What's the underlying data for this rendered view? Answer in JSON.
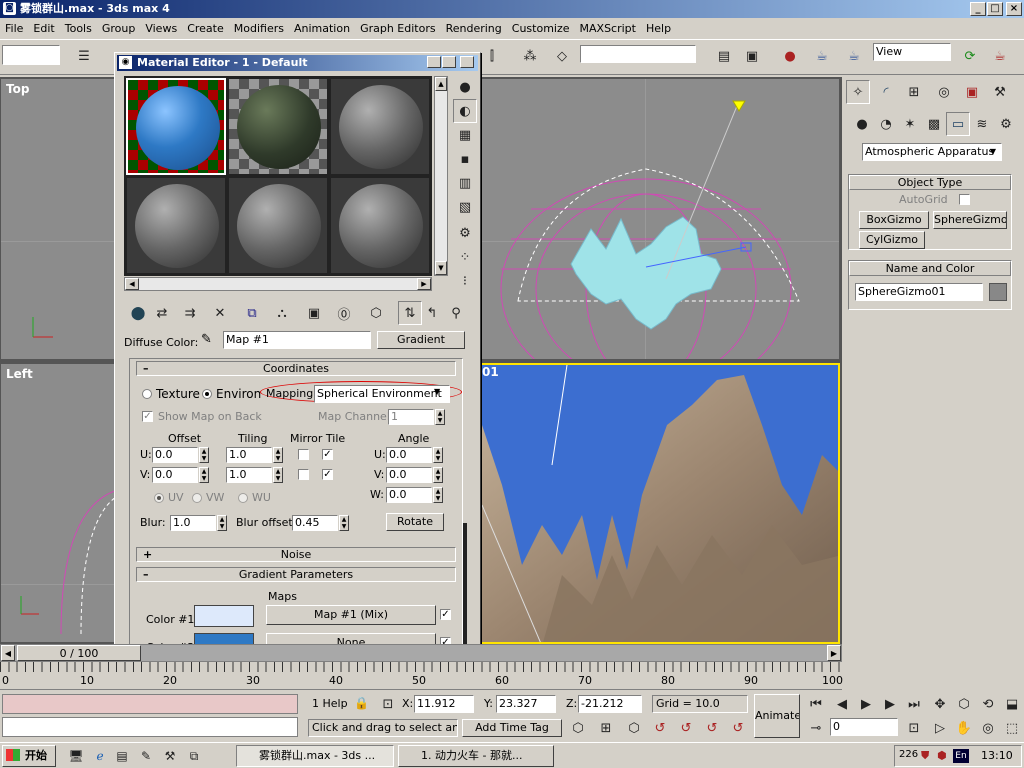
{
  "window": {
    "title": "雾锁群山.max - 3ds max 4",
    "min": "_",
    "max": "□",
    "close": "×"
  },
  "menu": [
    "File",
    "Edit",
    "Tools",
    "Group",
    "Views",
    "Create",
    "Modifiers",
    "Animation",
    "Graph Editors",
    "Rendering",
    "Customize",
    "MAXScript",
    "Help"
  ],
  "toolbar": {
    "view_select": "View"
  },
  "viewports": {
    "top": "Top",
    "left": "Left",
    "persp_num": "01"
  },
  "material_editor": {
    "title": "Material Editor - 1 - Default",
    "diffuse_label": "Diffuse Color:",
    "map_name": "Map #1",
    "map_type": "Gradient",
    "coordinates": {
      "header": "Coordinates",
      "texture": "Texture",
      "environ": "Environ",
      "mapping_label": "Mapping:",
      "mapping_value": "Spherical Environment",
      "show_map": "Show Map on Back",
      "map_channel_label": "Map Channel:",
      "map_channel_value": "1",
      "offset": "Offset",
      "tiling": "Tiling",
      "mirror_tile": "Mirror Tile",
      "angle": "Angle",
      "u_label": "U:",
      "v_label": "V:",
      "w_label": "W:",
      "u_offset": "0.0",
      "v_offset": "0.0",
      "u_tiling": "1.0",
      "v_tiling": "1.0",
      "u_angle": "0.0",
      "v_angle": "0.0",
      "w_angle": "0.0",
      "uv": "UV",
      "vw": "VW",
      "wu": "WU",
      "blur_label": "Blur:",
      "blur_value": "1.0",
      "blur_offset_label": "Blur offset:",
      "blur_offset_value": "0.45",
      "rotate": "Rotate"
    },
    "noise_header": "Noise",
    "gradient_header": "Gradient Parameters",
    "maps_label": "Maps",
    "color1_label": "Color #1",
    "color1_map": "Map #1 (Mix)",
    "color1_hex": "#dde9fb",
    "color2_label": "Color #2",
    "color2_map": "None",
    "color2_hex": "#2e79c5"
  },
  "command_panel": {
    "dropdown": "Atmospheric Apparatus",
    "object_type": "Object Type",
    "autogrid": "AutoGrid",
    "box_gizmo": "BoxGizmo",
    "sphere_gizmo": "SphereGizmo",
    "cyl_gizmo": "CylGizmo",
    "name_color": "Name and Color",
    "object_name": "SphereGizmo01"
  },
  "timeline": {
    "frame_display": "0 / 100",
    "ticks": [
      "10",
      "20",
      "30",
      "40",
      "50",
      "60",
      "70",
      "80",
      "90",
      "100"
    ],
    "ticks_lead": "0"
  },
  "status": {
    "help": "1 Help",
    "x_label": "X:",
    "x": "11.912",
    "y_label": "Y:",
    "y": "23.327",
    "z_label": "Z:",
    "z": "-21.212",
    "grid": "Grid = 10.0",
    "prompt": "Click and drag to select and m",
    "add_time_tag": "Add Time Tag",
    "animate": "Animate",
    "frame": "0"
  },
  "taskbar": {
    "start": "开始",
    "task1": "雾锁群山.max - 3ds ...",
    "task2": "1. 动力火车 - 那就...",
    "tray_num": "226",
    "lang": "En",
    "clock": "13:10"
  }
}
